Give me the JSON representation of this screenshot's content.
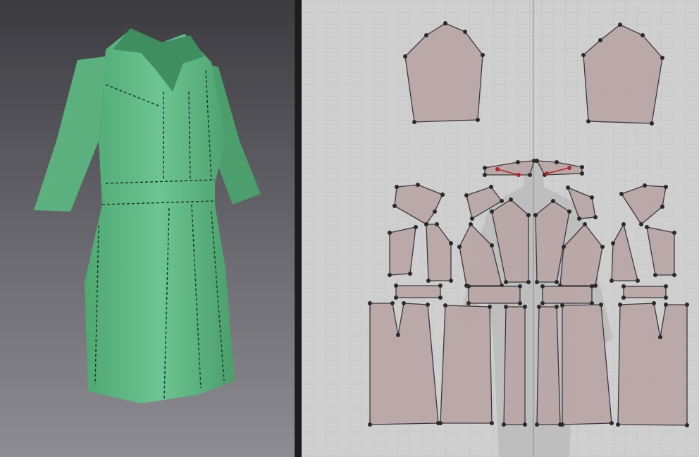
{
  "colors": {
    "garment": "#67bd88",
    "pattern_fill": "#b9a5a5",
    "pattern_outline": "#3a3a3a",
    "internal_line": "#b0282c",
    "grid_background": "#cfcfcf"
  }
}
